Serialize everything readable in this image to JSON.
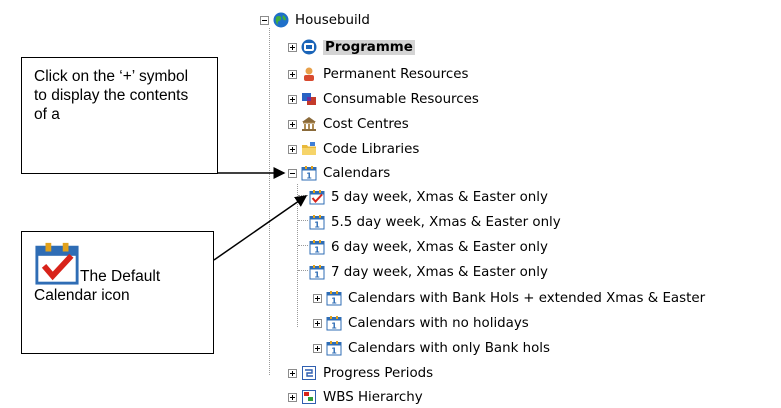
{
  "tree": {
    "root": {
      "label": "Housebuild",
      "icon": "globe-icon"
    },
    "items": [
      {
        "label": "Programme",
        "icon": "programme-icon",
        "selected": true
      },
      {
        "label": "Permanent Resources",
        "icon": "person-icon"
      },
      {
        "label": "Consumable Resources",
        "icon": "consumable-icon"
      },
      {
        "label": "Cost Centres",
        "icon": "bank-icon"
      },
      {
        "label": "Code Libraries",
        "icon": "folder-icon"
      },
      {
        "label": "Calendars",
        "icon": "calendar-icon",
        "expanded": true
      },
      {
        "label": "5 day week, Xmas & Easter only",
        "icon": "default-calendar-icon"
      },
      {
        "label": "5.5 day week, Xmas & Easter only",
        "icon": "calendar-icon"
      },
      {
        "label": "6 day week, Xmas & Easter only",
        "icon": "calendar-icon"
      },
      {
        "label": "7 day week, Xmas & Easter only",
        "icon": "calendar-icon"
      },
      {
        "label": "Calendars with Bank Hols + extended Xmas & Easter",
        "icon": "calendar-icon"
      },
      {
        "label": "Calendars with no holidays",
        "icon": "calendar-icon"
      },
      {
        "label": "Calendars with only Bank hols",
        "icon": "calendar-icon"
      },
      {
        "label": "Progress Periods",
        "icon": "progress-icon"
      },
      {
        "label": "WBS Hierarchy",
        "icon": "hierarchy-icon"
      }
    ]
  },
  "callouts": {
    "top_text": "Click on the ‘+’ symbol to display the contents of a",
    "bottom_text": "The Default Calendar icon"
  }
}
